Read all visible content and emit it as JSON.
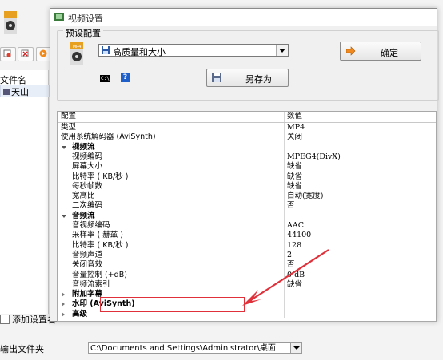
{
  "background_app": {
    "file_list_header": "文件名",
    "file_list_item": "天山",
    "add_setting_label": "添加设置名",
    "output_folder_label": "输出文件夹",
    "output_folder_value": "C:\\Documents and Settings\\Administrator\\桌面"
  },
  "dialog": {
    "title": "视频设置",
    "preset_group_label": "预设配置",
    "preset_selected": "高质量和大小",
    "ok_label": "确定",
    "saveas_label": "另存为",
    "console_icon_text": "C:\\",
    "help_icon_text": "?"
  },
  "grid": {
    "header": {
      "key": "配置",
      "value": "数值"
    },
    "rows": [
      {
        "key": "类型",
        "value": "MP4"
      },
      {
        "key": "使用系统解码器 (AviSynth)",
        "value": "关闭"
      },
      {
        "key": "视频流",
        "value": "",
        "category": true
      },
      {
        "key": "视频编码",
        "value": "MPEG4(DivX)"
      },
      {
        "key": "屏幕大小",
        "value": "缺省"
      },
      {
        "key": "比特率 ( KB/秒 )",
        "value": "缺省"
      },
      {
        "key": "每秒帧数",
        "value": "缺省"
      },
      {
        "key": "宽高比",
        "value": "自动(宽度)"
      },
      {
        "key": "二次编码",
        "value": "否"
      },
      {
        "key": "音频流",
        "value": "",
        "category": true
      },
      {
        "key": "音视频编码",
        "value": "AAC"
      },
      {
        "key": "采样率 ( 赫兹 )",
        "value": "44100"
      },
      {
        "key": "比特率 ( KB/秒 )",
        "value": "128"
      },
      {
        "key": "音频声道",
        "value": "2"
      },
      {
        "key": "关闭音效",
        "value": "否"
      },
      {
        "key": "音量控制 (+dB)",
        "value": "0 dB"
      },
      {
        "key": "音频流索引",
        "value": "缺省"
      },
      {
        "key": "附加字幕",
        "value": "",
        "category": true
      },
      {
        "key": "水印 (AviSynth)",
        "value": "",
        "category": true
      },
      {
        "key": "高级",
        "value": "",
        "category": true
      }
    ]
  },
  "colors": {
    "annotation": "#e0303a",
    "help_icon": "#1f5fc9"
  }
}
